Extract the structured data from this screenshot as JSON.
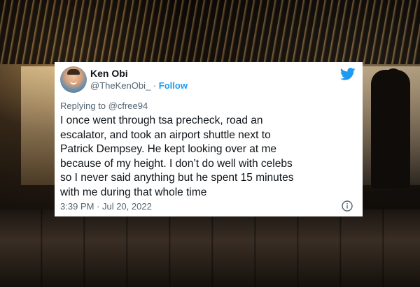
{
  "tweet": {
    "author_name": "Ken Obi",
    "handle": "@TheKenObi_",
    "separator": "·",
    "follow_label": "Follow",
    "replying_prefix": "Replying to",
    "replying_to": "@cfree94",
    "text": "I once went through tsa precheck, road an\nescalator, and took an airport shuttle next to\nPatrick Dempsey. He kept looking over at me\nbecause of my height. I don’t do well with celebs\nso I never said anything but he spent 15 minutes\nwith me during that whole time",
    "timestamp": "3:39 PM · Jul 20, 2022"
  },
  "icons": {
    "brand": "twitter-bird-icon",
    "info": "info-icon"
  },
  "colors": {
    "accent": "#1d9bf0",
    "secondary_text": "#536471",
    "primary_text": "#0f1419"
  }
}
